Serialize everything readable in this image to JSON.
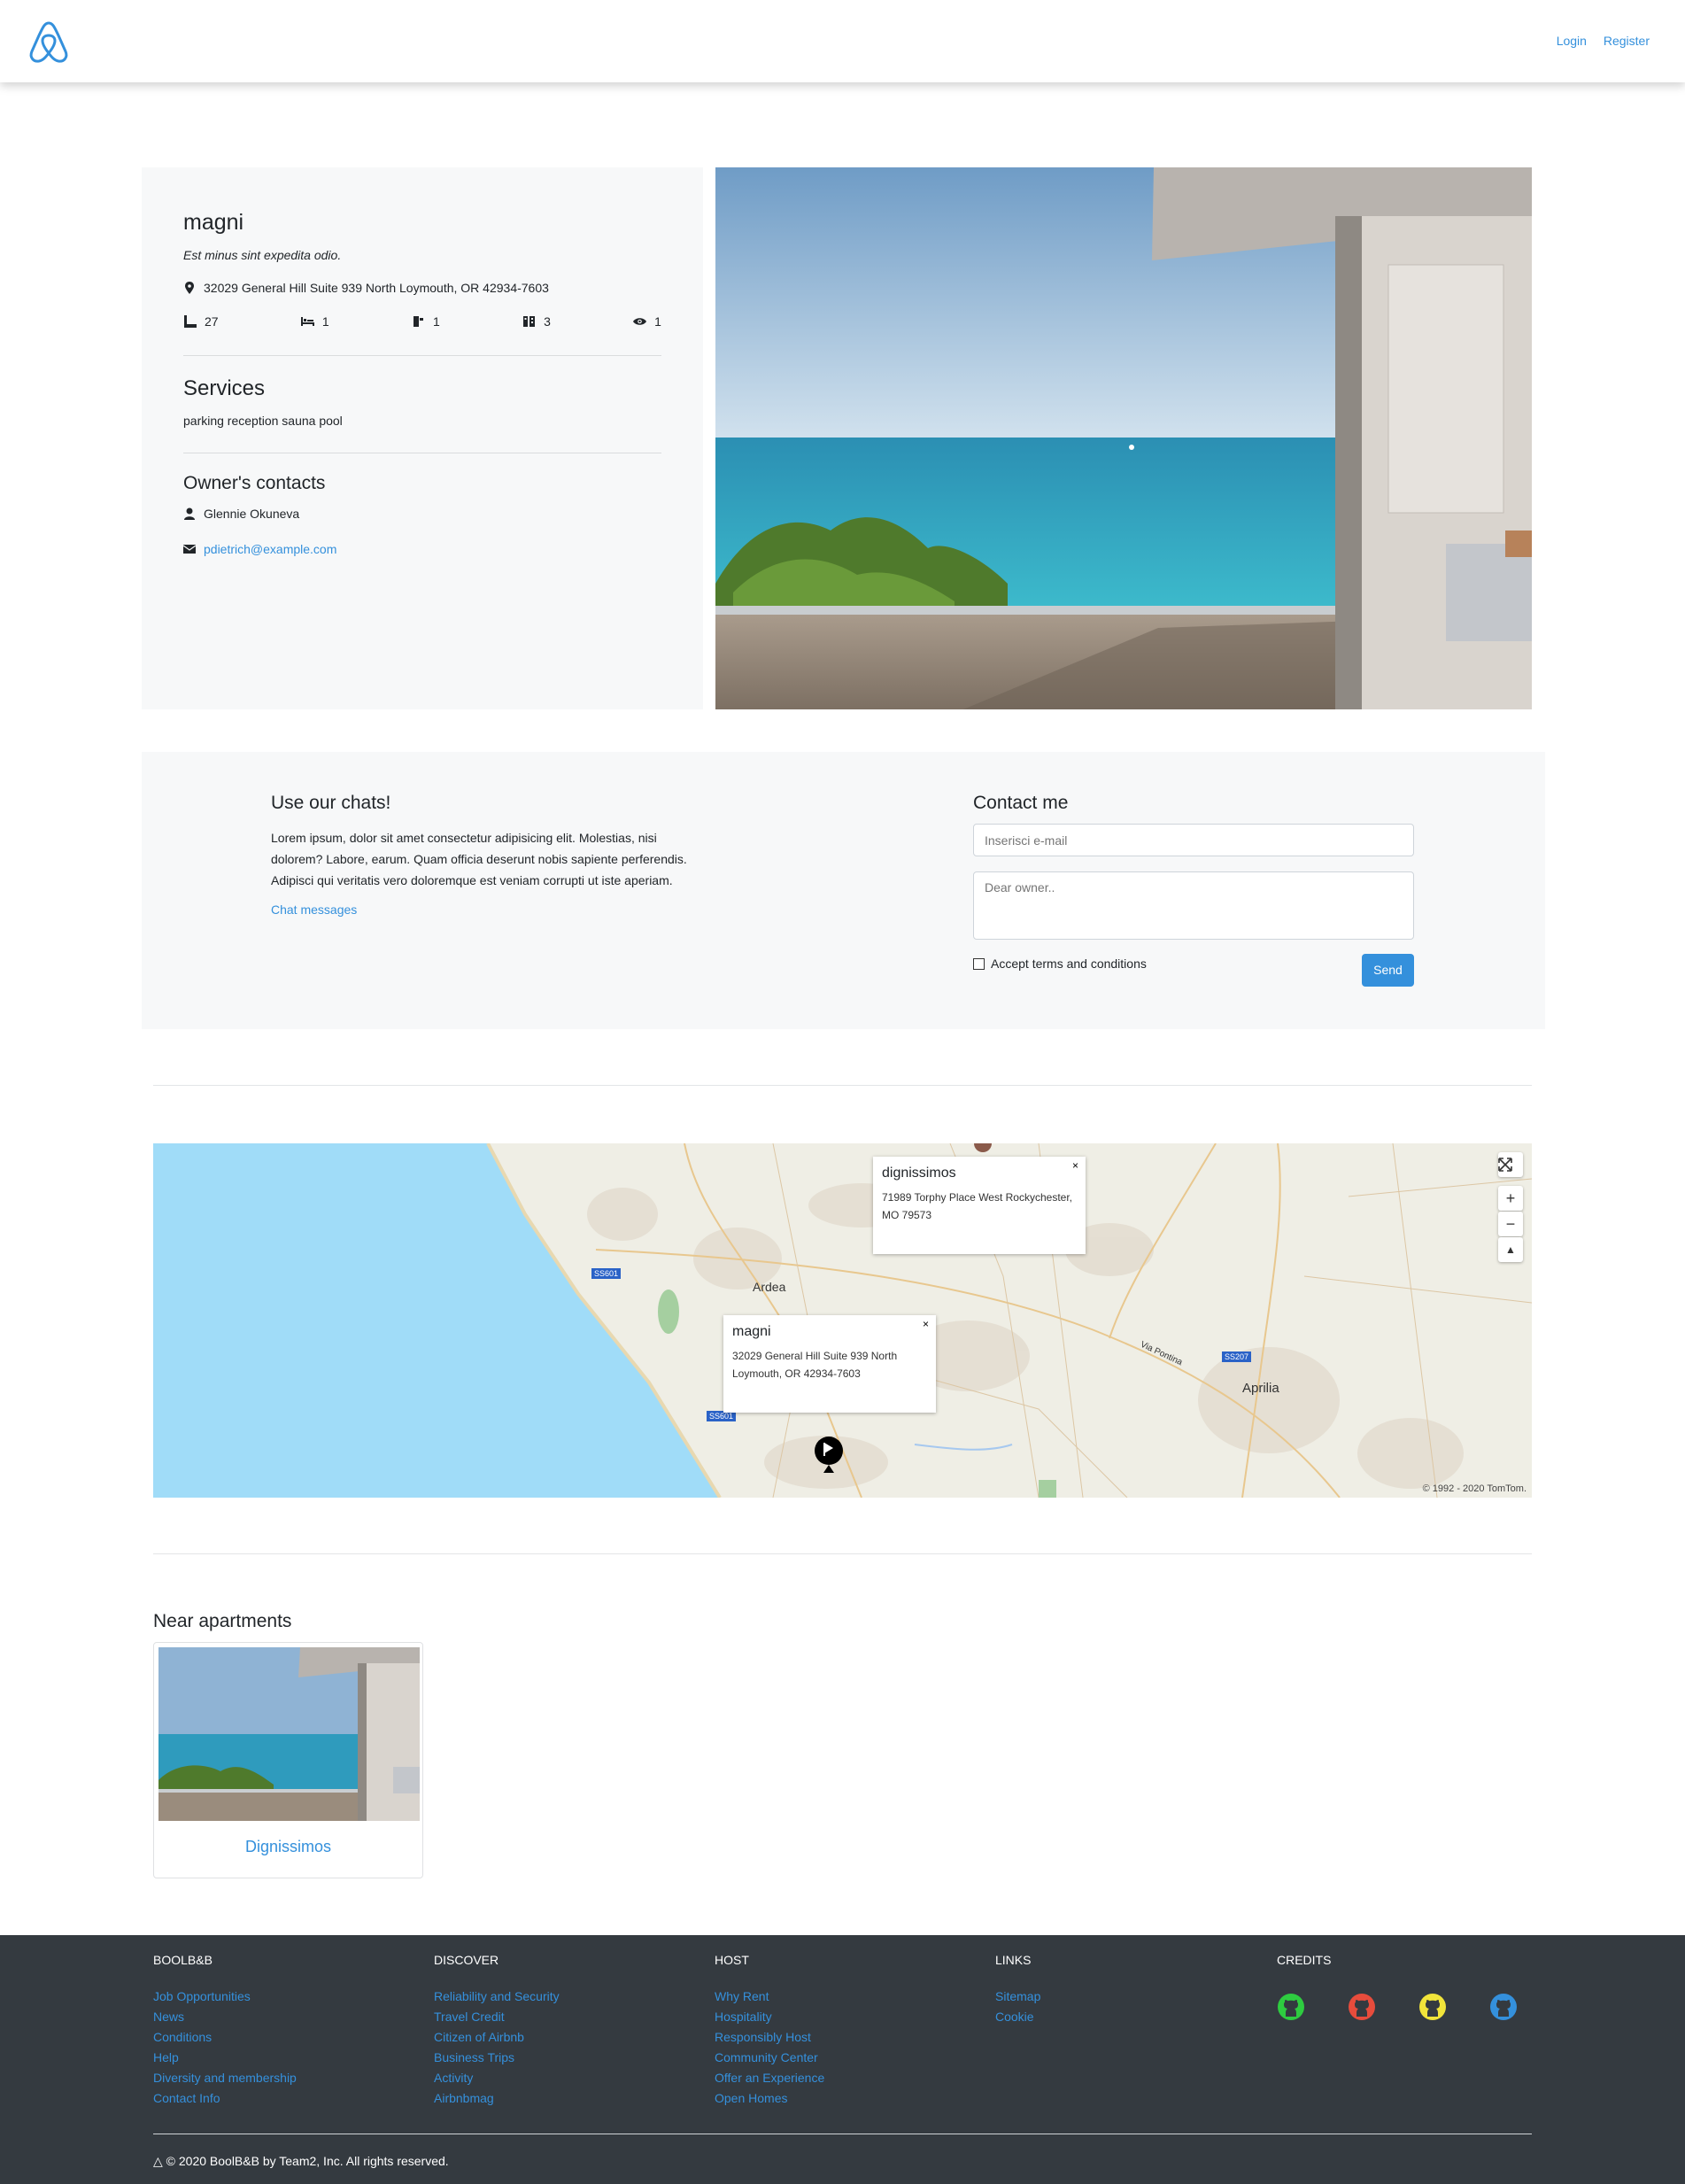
{
  "header": {
    "logo_icon": "airbnb-logo-icon",
    "login": "Login",
    "register": "Register"
  },
  "apartment": {
    "title": "magni",
    "description": "Est minus sint expedita odio.",
    "address": "32029 General Hill Suite 939 North Loymouth, OR 42934-7603",
    "stats": [
      {
        "icon": "ruler-icon",
        "value": "27"
      },
      {
        "icon": "bed-icon",
        "value": "1"
      },
      {
        "icon": "bathtub-icon",
        "value": "1"
      },
      {
        "icon": "building-icon",
        "value": "3"
      },
      {
        "icon": "eye-icon",
        "value": "1"
      }
    ],
    "services_title": "Services",
    "services": "parking reception sauna pool",
    "owner_title": "Owner's contacts",
    "owner_name": "Glennie Okuneva",
    "owner_email": "pdietrich@example.com"
  },
  "chat": {
    "title": "Use our chats!",
    "text": "Lorem ipsum, dolor sit amet consectetur adipisicing elit. Molestias, nisi dolorem? Labore, earum. Quam officia deserunt nobis sapiente perferendis. Adipisci qui veritatis vero doloremque est veniam corrupti ut iste aperiam.",
    "link": "Chat messages"
  },
  "contact_form": {
    "title": "Contact me",
    "email_placeholder": "Inserisci e-mail",
    "message_placeholder": "Dear owner..",
    "terms_label": "Accept terms and conditions",
    "send_label": "Send"
  },
  "map": {
    "popups": [
      {
        "title": "dignissimos",
        "address": "71989 Torphy Place West Rockychester, MO 79573"
      },
      {
        "title": "magni",
        "address": "32029 General Hill Suite 939 North Loymouth, OR 42934-7603"
      }
    ],
    "places": [
      "Ardea",
      "Aprilia",
      "Via Pontina"
    ],
    "roads": [
      "SS601",
      "SS601",
      "SS207"
    ],
    "zoom_in": "+",
    "zoom_out": "−",
    "credit": "© 1992 - 2020 TomTom."
  },
  "near": {
    "title": "Near apartments",
    "items": [
      {
        "title": "Dignissimos"
      }
    ]
  },
  "footer": {
    "columns": [
      {
        "heading": "BOOLB&B",
        "links": [
          "Job Opportunities",
          "News",
          "Conditions",
          "Help",
          "Diversity and membership",
          "Contact Info"
        ]
      },
      {
        "heading": "DISCOVER",
        "links": [
          "Reliability and Security",
          "Travel Credit",
          "Citizen of Airbnb",
          "Business Trips",
          "Activity",
          "Airbnbmag"
        ]
      },
      {
        "heading": "HOST",
        "links": [
          "Why Rent",
          "Hospitality",
          "Responsibly Host",
          "Community Center",
          "Offer an Experience",
          "Open Homes"
        ]
      },
      {
        "heading": "LINKS",
        "links": [
          "Sitemap",
          "Cookie"
        ]
      }
    ],
    "credits_heading": "CREDITS",
    "github_colors": [
      "#2ecc40",
      "#e74c3c",
      "#f1e43a",
      "#3490dc"
    ],
    "copyright": "© 2020 BoolB&B by Team2, Inc. All rights reserved."
  }
}
